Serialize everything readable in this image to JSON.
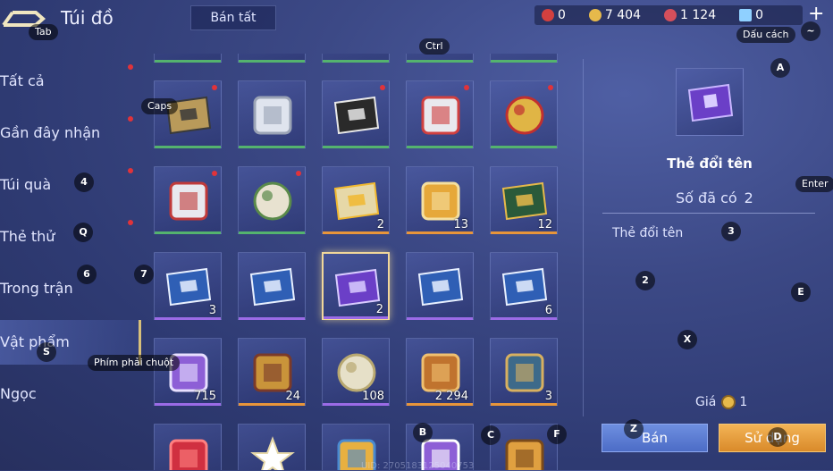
{
  "header": {
    "title": "Túi đồ",
    "sell_all": "Bán tất",
    "currencies": [
      {
        "icon": "red-gem-icon",
        "value": "0",
        "color": "#d2403f"
      },
      {
        "icon": "gold-coin-icon",
        "value": "7 404",
        "color": "#e6b94b"
      },
      {
        "icon": "ruby-icon",
        "value": "1 124",
        "color": "#d44f5b"
      },
      {
        "icon": "blue-voucher-icon",
        "value": "0",
        "color": "#8fd0ff"
      }
    ],
    "plus": "+"
  },
  "sidebar": {
    "items": [
      {
        "label": "Tất cả"
      },
      {
        "label": "Gần đây nhận"
      },
      {
        "label": "Túi quà"
      },
      {
        "label": "Thẻ thử"
      },
      {
        "label": "Trong trận"
      },
      {
        "label": "Vật phẩm"
      },
      {
        "label": "Ngọc"
      }
    ]
  },
  "grid": {
    "rows": [
      [
        {
          "name": "id-card-icon",
          "count": "",
          "rarity": "green",
          "dot": true
        },
        {
          "name": "map-fragment-icon",
          "count": "",
          "rarity": "green",
          "dot": false
        },
        {
          "name": "photo-cards-icon",
          "count": "",
          "rarity": "green",
          "dot": true
        },
        {
          "name": "hero-shirt-icon",
          "count": "",
          "rarity": "green",
          "dot": true
        },
        {
          "name": "pendant-icon",
          "count": "",
          "rarity": "green",
          "dot": true
        }
      ],
      [
        {
          "name": "bucket-icon",
          "count": "",
          "rarity": "green",
          "dot": true
        },
        {
          "name": "ornament-ball-icon",
          "count": "",
          "rarity": "green",
          "dot": true
        },
        {
          "name": "star-ticket-icon",
          "count": "2",
          "rarity": "orange",
          "dot": false
        },
        {
          "name": "golden-trophy-icon",
          "count": "13",
          "rarity": "orange",
          "dot": false
        },
        {
          "name": "gold-x2-card-icon",
          "count": "12",
          "rarity": "orange",
          "dot": false
        }
      ],
      [
        {
          "name": "exp-x2-card-icon",
          "count": "3",
          "rarity": "purple",
          "dot": false
        },
        {
          "name": "exp-x2-card-icon",
          "count": "",
          "rarity": "purple",
          "dot": false
        },
        {
          "name": "rename-card-icon",
          "count": "2",
          "rarity": "purple",
          "dot": false,
          "selected": true
        },
        {
          "name": "exp-x2-card-icon",
          "count": "",
          "rarity": "purple",
          "dot": false
        },
        {
          "name": "exp-x2-card-icon",
          "count": "6",
          "rarity": "purple",
          "dot": false
        }
      ],
      [
        {
          "name": "helmet-icon",
          "count": "715",
          "rarity": "purple",
          "dot": false
        },
        {
          "name": "scroll-telescope-icon",
          "count": "24",
          "rarity": "orange",
          "dot": false
        },
        {
          "name": "silver-orb-icon",
          "count": "108",
          "rarity": "purple",
          "dot": false
        },
        {
          "name": "armor-chest-icon",
          "count": "2 294",
          "rarity": "orange",
          "dot": false
        },
        {
          "name": "map-scroll-icon",
          "count": "3",
          "rarity": "orange",
          "dot": false
        }
      ],
      [
        {
          "name": "red-crystal-icon",
          "count": "",
          "rarity": "orange",
          "dot": false
        },
        {
          "name": "white-star-icon",
          "count": "",
          "rarity": "orange",
          "dot": false
        },
        {
          "name": "gift-box-icon",
          "count": "",
          "rarity": "orange",
          "dot": false
        },
        {
          "name": "purple-shard-icon",
          "count": "",
          "rarity": "orange",
          "dot": false
        },
        {
          "name": "gold-scroll-icon",
          "count": "",
          "rarity": "orange",
          "dot": false
        }
      ]
    ]
  },
  "detail": {
    "name": "Thẻ đổi tên",
    "owned_label": "Số đã có",
    "owned_value": "2",
    "description": "Thẻ đổi tên",
    "price_label": "Giá",
    "price_value": "1",
    "sell_button": "Bán",
    "use_button": "Sử dụng"
  },
  "uid": "UID: 2705183125040753",
  "key_hints": [
    {
      "label": "Tab"
    },
    {
      "label": "Ctrl"
    },
    {
      "label": "Dấu cách"
    },
    {
      "label": "~"
    },
    {
      "label": "A"
    },
    {
      "label": "Caps"
    },
    {
      "label": "Enter"
    },
    {
      "label": "4"
    },
    {
      "label": "3"
    },
    {
      "label": "Q"
    },
    {
      "label": "6"
    },
    {
      "label": "7"
    },
    {
      "label": "2"
    },
    {
      "label": "E"
    },
    {
      "label": "X"
    },
    {
      "label": "S"
    },
    {
      "label": "Phím phải chuột"
    },
    {
      "label": "B"
    },
    {
      "label": "C"
    },
    {
      "label": "F"
    },
    {
      "label": "Z"
    },
    {
      "label": "D"
    }
  ]
}
